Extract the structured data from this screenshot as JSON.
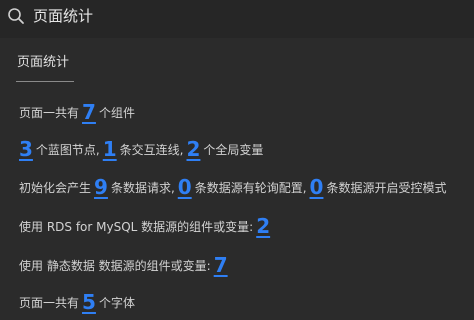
{
  "search": {
    "value": "页面统计"
  },
  "tab": {
    "label": "页面统计"
  },
  "stats": {
    "row1": {
      "prefix": "页面一共有",
      "count": "7",
      "suffix": "个组件"
    },
    "row2": {
      "n1": "3",
      "t1": "个蓝图节点,",
      "n2": "1",
      "t2": "条交互连线,",
      "n3": "2",
      "t3": "个全局变量"
    },
    "row3": {
      "prefix": "初始化会产生",
      "n1": "9",
      "t1": "条数据请求,",
      "n2": "0",
      "t2": "条数据源有轮询配置,",
      "n3": "0",
      "t3": "条数据源开启受控模式"
    },
    "row4": {
      "prefix": "使用 RDS for MySQL 数据源的组件或变量:",
      "count": "2"
    },
    "row5": {
      "prefix": "使用 静态数据 数据源的组件或变量:",
      "count": "7"
    },
    "row6": {
      "prefix": "页面一共有",
      "count": "5",
      "suffix": "个字体"
    }
  },
  "colors": {
    "background": "#2b2b2b",
    "search_bar": "#262626",
    "accent": "#2f7ff4",
    "text": "#d2d2d2"
  },
  "icons": {
    "search": "search-icon"
  }
}
